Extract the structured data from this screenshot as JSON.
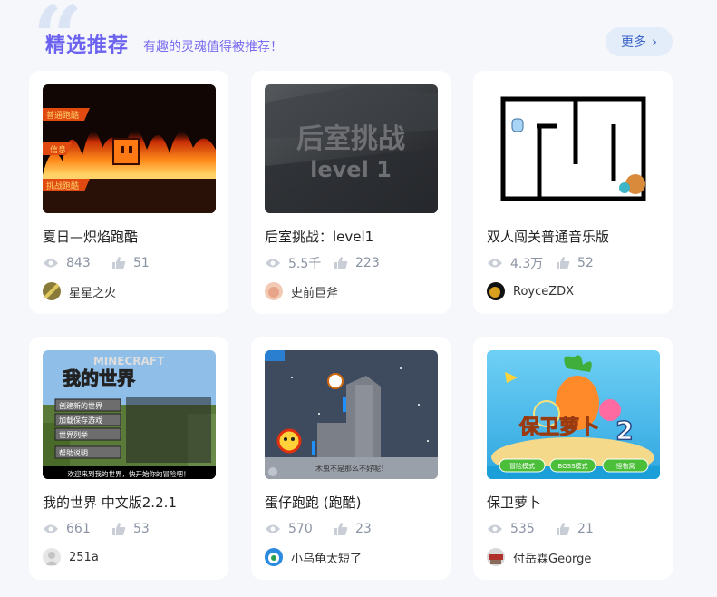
{
  "header": {
    "title": "精选推荐",
    "subtitle": "有趣的灵魂值得被推荐！",
    "more_label": "更多"
  },
  "cards": [
    {
      "title": "夏日—炽焰跑酷",
      "views": "843",
      "likes": "51",
      "author": "星星之火",
      "thumb_labels": [
        "普通跑酷",
        "信息",
        "挑战跑酷"
      ]
    },
    {
      "title": "后室挑战：level1",
      "views": "5.5千",
      "likes": "223",
      "author": "史前巨斧",
      "thumb_labels": [
        "后室挑战",
        "level 1"
      ]
    },
    {
      "title": "双人闯关普通音乐版",
      "views": "4.3万",
      "likes": "52",
      "author": "RoyceZDX"
    },
    {
      "title": "我的世界 中文版2.2.1",
      "views": "661",
      "likes": "53",
      "author": "251a",
      "thumb_labels": [
        "MINECRAFT",
        "我的世界",
        "创建新的世界",
        "加载保存游戏",
        "世界列举",
        "帮助说明",
        "欢迎来到我的世界，快开始你的冒险吧！"
      ]
    },
    {
      "title": "蛋仔跑跑 (跑酷)",
      "views": "570",
      "likes": "23",
      "author": "小乌龟太短了",
      "thumb_labels": [
        "木虫不是那么不好呢！"
      ]
    },
    {
      "title": "保卫萝卜",
      "views": "535",
      "likes": "21",
      "author": "付岳霖George",
      "thumb_labels": [
        "保卫萝卜",
        "2",
        "冒险模式",
        "BOSS模式",
        "怪物窝"
      ]
    }
  ],
  "colors": {
    "title": "#6c62f0",
    "more_bg": "#e3ecf9",
    "more_text": "#3a63c9",
    "stat_text": "#8a93a3",
    "page_bg": "#f5f7fb"
  },
  "icons": {
    "views": "eye-icon",
    "likes": "thumbs-up-icon",
    "more": "chevron-right-icon"
  }
}
